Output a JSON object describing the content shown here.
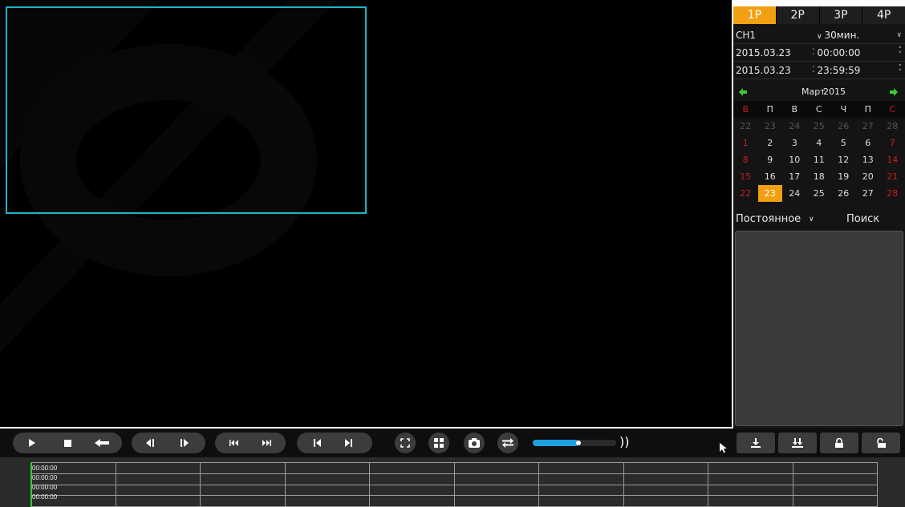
{
  "layout_tabs": [
    "1P",
    "2P",
    "3P",
    "4P"
  ],
  "active_layout": "1P",
  "channel": {
    "value": "CH1",
    "duration": "30мин."
  },
  "start": {
    "date": "2015.03.23",
    "time": "00:00:00"
  },
  "end": {
    "date": "2015.03.23",
    "time": "23:59:59"
  },
  "calendar": {
    "month": "Март",
    "year": "2015",
    "weekdays": [
      "В",
      "П",
      "В",
      "С",
      "Ч",
      "П",
      "С"
    ],
    "weeks": [
      [
        "22",
        "23",
        "24",
        "25",
        "26",
        "27",
        "28"
      ],
      [
        "1",
        "2",
        "3",
        "4",
        "5",
        "6",
        "7"
      ],
      [
        "8",
        "9",
        "10",
        "11",
        "12",
        "13",
        "14"
      ],
      [
        "15",
        "16",
        "17",
        "18",
        "19",
        "20",
        "21"
      ],
      [
        "22",
        "23",
        "24",
        "25",
        "26",
        "27",
        "28"
      ]
    ],
    "selected_day": "23"
  },
  "record_type": "Постоянное",
  "search_label": "Поиск",
  "volume_level": 0.55,
  "timeline": {
    "labels": [
      "00:00:00",
      "00:00:00",
      "00:00:00",
      "00:00:00"
    ]
  },
  "colors": {
    "accent": "#f2a013",
    "selection": "#1fb4c8",
    "volume": "#1ea0e0",
    "cursor": "#3ccc3c"
  }
}
